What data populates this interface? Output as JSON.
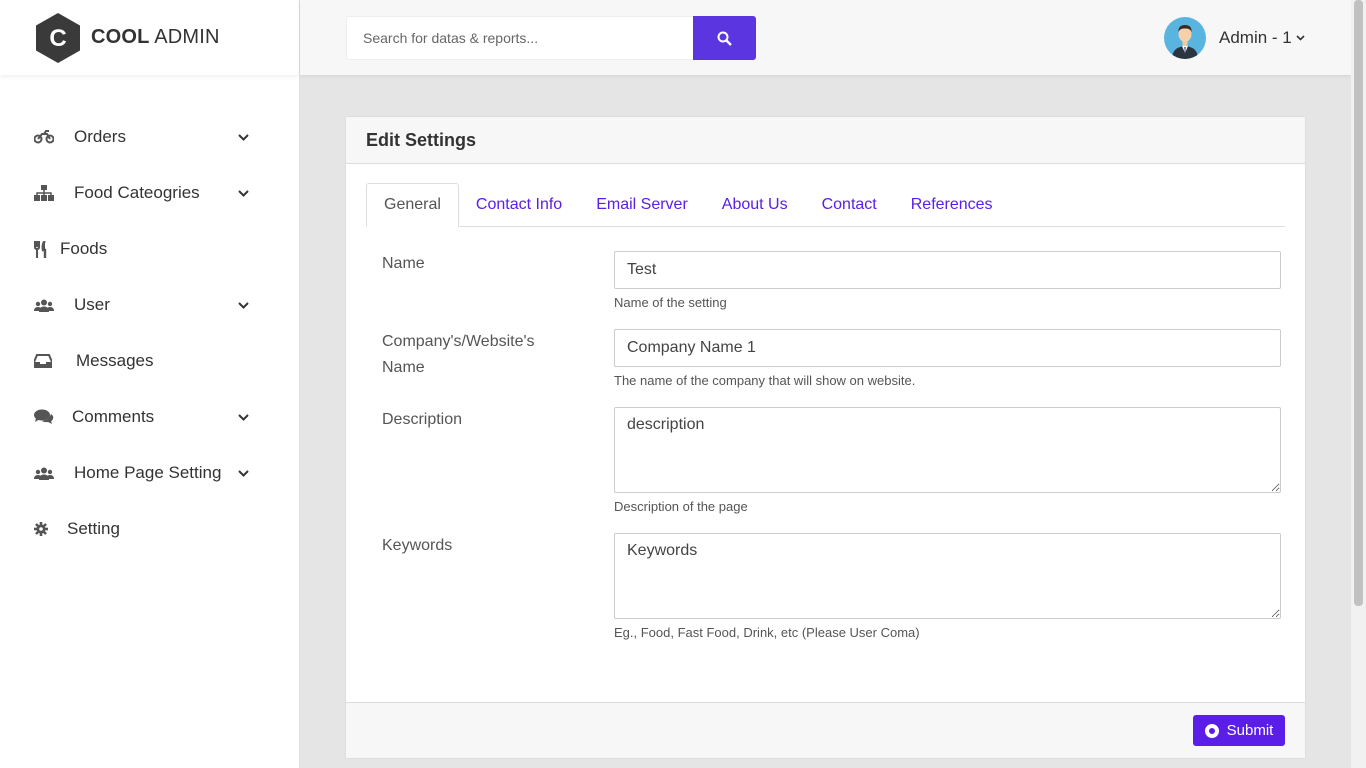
{
  "logo": {
    "letter": "C",
    "text_bold": "COOL",
    "text_regular": "ADMIN"
  },
  "sidebar": {
    "items": [
      {
        "label": "Orders",
        "icon": "motorcycle-icon",
        "has_arrow": true
      },
      {
        "label": "Food Cateogries",
        "icon": "sitemap-icon",
        "has_arrow": true
      },
      {
        "label": "Foods",
        "icon": "utensils-icon",
        "has_arrow": false
      },
      {
        "label": "User",
        "icon": "users-icon",
        "has_arrow": true
      },
      {
        "label": "Messages",
        "icon": "inbox-icon",
        "has_arrow": false
      },
      {
        "label": "Comments",
        "icon": "comments-icon",
        "has_arrow": true
      },
      {
        "label": "Home Page Setting",
        "icon": "users-icon",
        "has_arrow": true
      },
      {
        "label": "Setting",
        "icon": "gear-icon",
        "has_arrow": false
      }
    ]
  },
  "header": {
    "search_placeholder": "Search for datas & reports...",
    "user_name": "Admin - 1"
  },
  "card": {
    "title": "Edit Settings",
    "tabs": [
      {
        "label": "General",
        "active": true
      },
      {
        "label": "Contact Info",
        "active": false
      },
      {
        "label": "Email Server",
        "active": false
      },
      {
        "label": "About Us",
        "active": false
      },
      {
        "label": "Contact",
        "active": false
      },
      {
        "label": "References",
        "active": false
      }
    ],
    "fields": {
      "name": {
        "label": "Name",
        "value": "Test",
        "help": "Name of the setting"
      },
      "company": {
        "label": "Company's/Website's Name",
        "value": "Company Name 1",
        "help": "The name of the company that will show on website."
      },
      "description": {
        "label": "Description",
        "value": "description",
        "help": "Description of the page"
      },
      "keywords": {
        "label": "Keywords",
        "value": "Keywords",
        "help": "Eg., Food, Fast Food, Drink, etc (Please User Coma)"
      }
    },
    "submit_label": "Submit"
  },
  "colors": {
    "accent": "#5a1ee8",
    "search_button": "#5a35e0"
  }
}
